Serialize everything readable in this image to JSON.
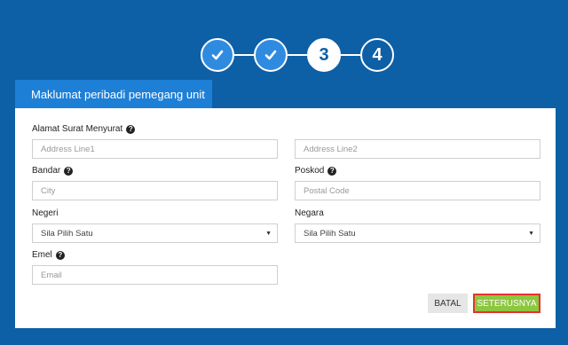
{
  "stepper": {
    "steps": [
      {
        "label": "",
        "state": "done",
        "icon": "check-icon"
      },
      {
        "label": "",
        "state": "done",
        "icon": "check-icon"
      },
      {
        "label": "3",
        "state": "current"
      },
      {
        "label": "4",
        "state": "todo"
      }
    ]
  },
  "section": {
    "title": "Maklumat peribadi pemegang unit"
  },
  "form": {
    "address": {
      "label": "Alamat Surat Menyurat",
      "line1_placeholder": "Address Line1",
      "line2_placeholder": "Address Line2"
    },
    "city": {
      "label": "Bandar",
      "placeholder": "City"
    },
    "postcode": {
      "label": "Poskod",
      "placeholder": "Postal Code"
    },
    "state": {
      "label": "Negeri",
      "value": "Sila Pilih Satu"
    },
    "country": {
      "label": "Negara",
      "value": "Sila Pilih Satu"
    },
    "email": {
      "label": "Emel",
      "placeholder": "Email"
    }
  },
  "buttons": {
    "cancel": "BATAL",
    "next": "SETERUSNYA"
  },
  "colors": {
    "background": "#0d5fa6",
    "tab": "#1e7fd6",
    "next_button": "#8dc63f",
    "next_button_outline": "#e8312f"
  }
}
